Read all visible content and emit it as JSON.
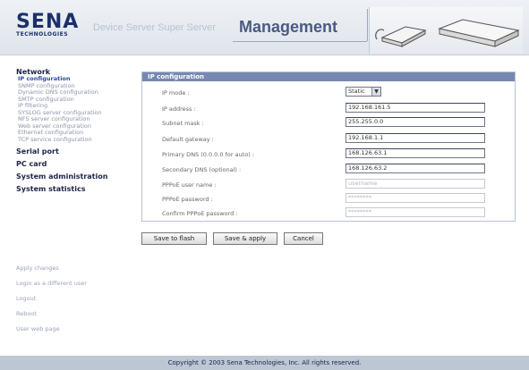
{
  "header": {
    "logo_main": "SENA",
    "logo_sub": "TECHNOLOGIES",
    "faded_text": "Device Server Super Server",
    "title": "Management"
  },
  "sidebar": {
    "network_label": "Network",
    "network_items": [
      "IP configuration",
      "SNMP configuration",
      "Dynamic DNS configuration",
      "SMTP configuration",
      "IP filtering",
      "SYSLOG server configuration",
      "NFS server configuration",
      "Web server configuration",
      "Ethernet configuration",
      "TCP service configuration"
    ],
    "sections": [
      "Serial port",
      "PC card",
      "System administration",
      "System statistics"
    ],
    "actions": [
      "Apply changes",
      "Login as a different user",
      "Logout",
      "Reboot",
      "User web page"
    ]
  },
  "panel": {
    "title": "IP configuration",
    "rows": [
      {
        "label": "IP mode :",
        "value": "Static",
        "kind": "select"
      },
      {
        "label": "IP address :",
        "value": "192.168.161.5",
        "kind": "input"
      },
      {
        "label": "Subnet mask :",
        "value": "255.255.0.0",
        "kind": "input"
      },
      {
        "label": "Default gateway :",
        "value": "192.168.1.1",
        "kind": "input"
      },
      {
        "label": "Primary DNS (0.0.0.0 for auto) :",
        "value": "168.126.63.1",
        "kind": "input"
      },
      {
        "label": "Secondary DNS (optional) :",
        "value": "168.126.63.2",
        "kind": "input"
      },
      {
        "label": "PPPoE user name :",
        "value": "username",
        "kind": "disabled"
      },
      {
        "label": "PPPoE password :",
        "value": "********",
        "kind": "disabled"
      },
      {
        "label": "Confirm PPPoE password :",
        "value": "********",
        "kind": "disabled"
      }
    ]
  },
  "buttons": {
    "save_flash": "Save to flash",
    "save_apply": "Save & apply",
    "cancel": "Cancel"
  },
  "footer": {
    "copyright": "Copyright © 2003 Sena Technologies, Inc. All rights reserved."
  }
}
